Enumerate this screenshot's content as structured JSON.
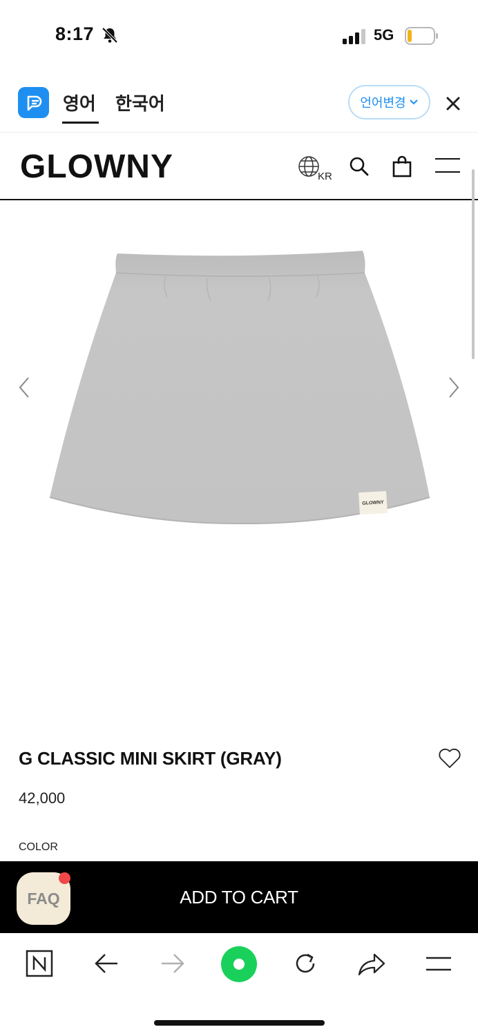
{
  "status_bar": {
    "time": "8:17",
    "network": "5G",
    "bell_icon": "bell-slash-icon",
    "signal_icon": "cellular-signal-icon",
    "battery_icon": "battery-low-icon"
  },
  "translate_bar": {
    "tabs": [
      {
        "label": "영어",
        "active": true
      },
      {
        "label": "한국어",
        "active": false
      }
    ],
    "change_language_label": "언어변경",
    "accent_color": "#1e8ff0"
  },
  "header": {
    "brand": "GLOWNY",
    "region": "KR"
  },
  "product": {
    "image_label": "GLOWNY",
    "title": "G CLASSIC MINI SKIRT (GRAY)",
    "price": "42,000",
    "color_label": "COLOR"
  },
  "cart_bar": {
    "add_to_cart_label": "ADD TO CART",
    "faq_label": "FAQ"
  },
  "toolbar": {
    "icons": [
      "naver-icon",
      "back-arrow-icon",
      "forward-arrow-icon",
      "green-dot-icon",
      "refresh-icon",
      "share-icon",
      "menu-icon"
    ]
  }
}
